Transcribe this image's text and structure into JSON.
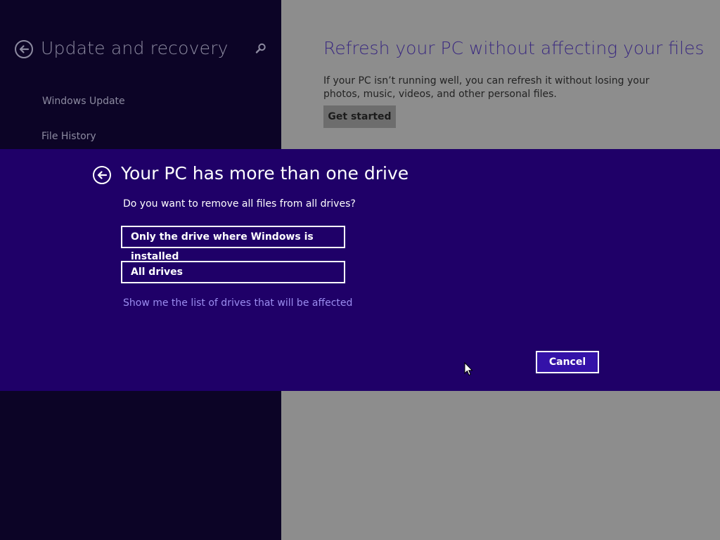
{
  "settings": {
    "title": "Update and recovery",
    "back_icon": "back-arrow-icon",
    "search_icon": "search-icon",
    "nav_items": [
      {
        "label": "Windows Update"
      },
      {
        "label": "File History"
      }
    ]
  },
  "content": {
    "title": "Refresh your PC without affecting your files",
    "description": "If your PC isn’t running well, you can refresh it without losing your photos, music, videos, and other personal files.",
    "get_started_label": "Get started"
  },
  "dialog": {
    "title": "Your PC has more than one drive",
    "question": "Do you want to remove all files from all drives?",
    "options": [
      {
        "label": "Only the drive where Windows is installed"
      },
      {
        "label": "All drives"
      }
    ],
    "link_text": "Show me the list of drives that will be affected",
    "cancel_label": "Cancel",
    "back_icon": "back-arrow-icon"
  },
  "colors": {
    "left_pane_bg": "#0c0426",
    "dialog_bg": "#1f0068",
    "accent": "#3412a8",
    "link": "#9b8df0"
  }
}
